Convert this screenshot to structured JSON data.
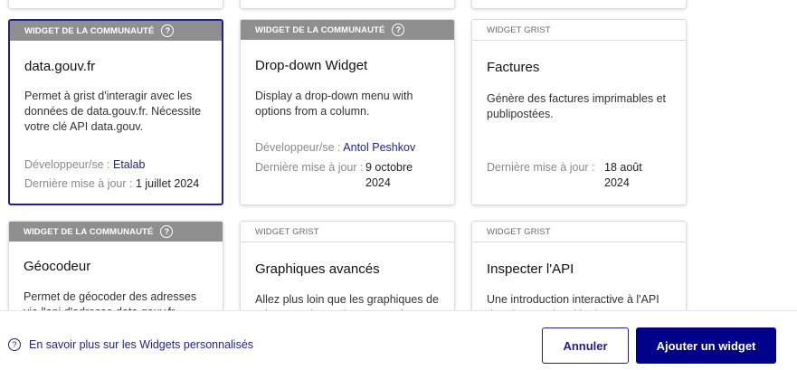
{
  "cards": [
    {
      "band": "WIDGET DE LA COMMUNAUTÉ",
      "title": "data.gouv.fr",
      "description": "Permet à grist d'interagir avec les données de data.gouv.fr. Nécessite votre clé API data.gouv.",
      "developer_label": "Développeur/se : ",
      "developer": "Etalab",
      "updated_label": "Dernière mise à jour : ",
      "updated": "1 juillet 2024"
    },
    {
      "band": "WIDGET DE LA COMMUNAUTÉ",
      "title": "Drop-down Widget",
      "description": "Display a drop-down menu with options from a column.",
      "developer_label": "Développeur/se : ",
      "developer": "Antol Peshkov",
      "updated_label": "Dernière mise à jour :",
      "updated": "9 octobre 2024"
    },
    {
      "band": "WIDGET GRIST",
      "title": "Factures",
      "description": "Génère des factures imprimables et publipostées.",
      "updated_label": "Dernière mise à jour :",
      "updated": "18 août 2024"
    },
    {
      "band": "WIDGET DE LA COMMUNAUTÉ",
      "title": "Géocodeur",
      "description": "Permet de géocoder des adresses via l'api d'adresse data.gouv.fr"
    },
    {
      "band": "WIDGET GRIST",
      "title": "Graphiques avancés",
      "description": "Allez plus loin que les graphiques de grist avec des options avancées"
    },
    {
      "band": "WIDGET GRIST",
      "title": "Inspecter l'API",
      "description": "Une introduction interactive à l'API de grist pour les développeurs"
    }
  ],
  "footer": {
    "help_text": "En savoir plus sur les Widgets personnalisés",
    "cancel_label": "Annuler",
    "add_label": "Ajouter un widget"
  }
}
